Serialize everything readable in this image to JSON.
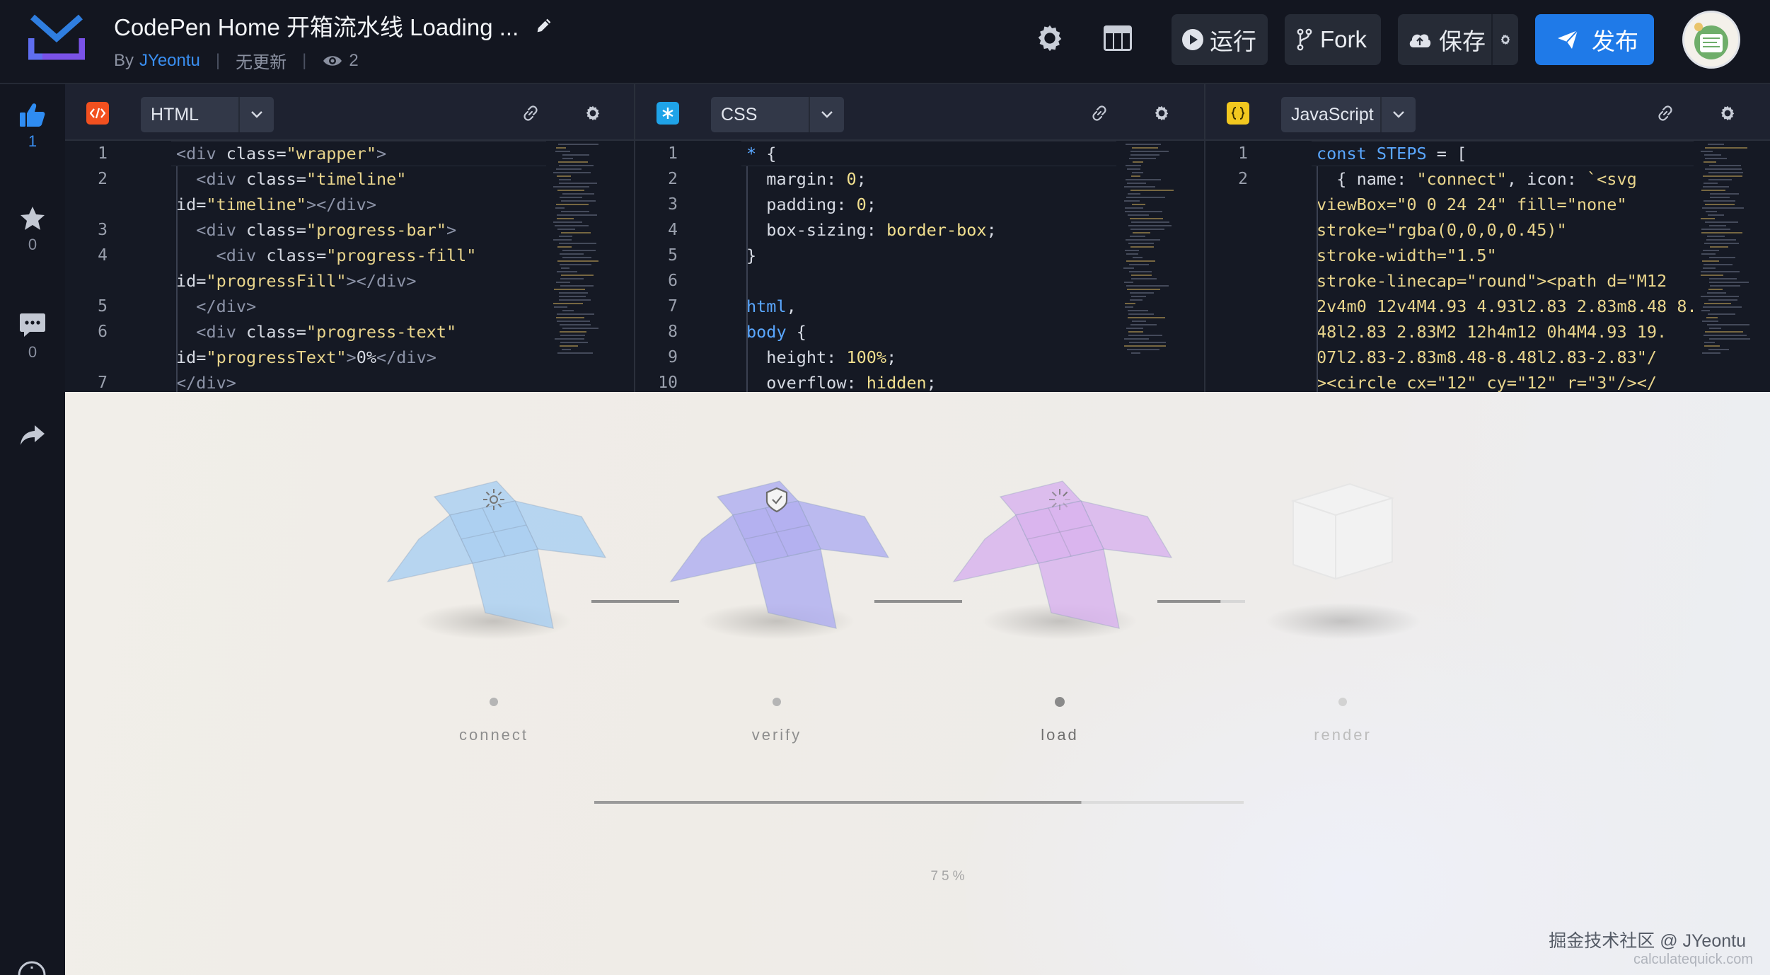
{
  "header": {
    "title": "CodePen Home 开箱流水线 Loading ...",
    "by_label": "By",
    "author": "JYeontu",
    "status": "无更新",
    "views": "2",
    "buttons": {
      "run": "运行",
      "fork": "Fork",
      "save": "保存",
      "publish": "发布"
    }
  },
  "rail": {
    "likes": "1",
    "stars": "0",
    "comments": "0"
  },
  "panes": {
    "html": {
      "label": "HTML",
      "lines": [
        {
          "n": "1",
          "segments": [
            [
              "t",
              "<div "
            ],
            [
              "a",
              "class="
            ],
            [
              "s",
              "\"wrapper\""
            ],
            [
              "t",
              ">"
            ]
          ]
        },
        {
          "n": "2",
          "segments": [
            [
              "p",
              "  "
            ],
            [
              "t",
              "<div "
            ],
            [
              "a",
              "class="
            ],
            [
              "s",
              "\"timeline\""
            ]
          ]
        },
        {
          "n": "",
          "segments": [
            [
              "a",
              "id="
            ],
            [
              "s",
              "\"timeline\""
            ],
            [
              "t",
              "></div>"
            ]
          ]
        },
        {
          "n": "3",
          "segments": [
            [
              "p",
              "  "
            ],
            [
              "t",
              "<div "
            ],
            [
              "a",
              "class="
            ],
            [
              "s",
              "\"progress-bar\""
            ],
            [
              "t",
              ">"
            ]
          ]
        },
        {
          "n": "4",
          "segments": [
            [
              "p",
              "    "
            ],
            [
              "t",
              "<div "
            ],
            [
              "a",
              "class="
            ],
            [
              "s",
              "\"progress-fill\""
            ]
          ]
        },
        {
          "n": "",
          "segments": [
            [
              "a",
              "id="
            ],
            [
              "s",
              "\"progressFill\""
            ],
            [
              "t",
              "></div>"
            ]
          ]
        },
        {
          "n": "5",
          "segments": [
            [
              "p",
              "  "
            ],
            [
              "t",
              "</div>"
            ]
          ]
        },
        {
          "n": "6",
          "segments": [
            [
              "p",
              "  "
            ],
            [
              "t",
              "<div "
            ],
            [
              "a",
              "class="
            ],
            [
              "s",
              "\"progress-text\""
            ]
          ]
        },
        {
          "n": "",
          "segments": [
            [
              "a",
              "id="
            ],
            [
              "s",
              "\"progressText\""
            ],
            [
              "t",
              ">"
            ],
            [
              "p",
              "0%"
            ],
            [
              "t",
              "</div>"
            ]
          ]
        },
        {
          "n": "7",
          "segments": [
            [
              "t",
              "</div>"
            ]
          ]
        }
      ]
    },
    "css": {
      "label": "CSS",
      "lines": [
        {
          "n": "1",
          "segments": [
            [
              "k",
              "* "
            ],
            [
              "p",
              "{"
            ]
          ]
        },
        {
          "n": "2",
          "segments": [
            [
              "p",
              "  margin: "
            ],
            [
              "m",
              "0"
            ],
            [
              "p",
              ";"
            ]
          ]
        },
        {
          "n": "3",
          "segments": [
            [
              "p",
              "  padding: "
            ],
            [
              "m",
              "0"
            ],
            [
              "p",
              ";"
            ]
          ]
        },
        {
          "n": "4",
          "segments": [
            [
              "p",
              "  box-sizing: "
            ],
            [
              "m",
              "border-box"
            ],
            [
              "p",
              ";"
            ]
          ]
        },
        {
          "n": "5",
          "segments": [
            [
              "p",
              "}"
            ]
          ]
        },
        {
          "n": "6",
          "segments": []
        },
        {
          "n": "7",
          "segments": [
            [
              "k",
              "html"
            ],
            [
              "p",
              ","
            ]
          ]
        },
        {
          "n": "8",
          "segments": [
            [
              "k",
              "body "
            ],
            [
              "p",
              "{"
            ]
          ]
        },
        {
          "n": "9",
          "segments": [
            [
              "p",
              "  height: "
            ],
            [
              "m",
              "100%"
            ],
            [
              "p",
              ";"
            ]
          ]
        },
        {
          "n": "10",
          "segments": [
            [
              "p",
              "  overflow: "
            ],
            [
              "m",
              "hidden"
            ],
            [
              "p",
              ";"
            ]
          ]
        }
      ]
    },
    "js": {
      "label": "JavaScript",
      "lines": [
        {
          "n": "1",
          "segments": [
            [
              "k",
              "const STEPS "
            ],
            [
              "p",
              "= ["
            ]
          ]
        },
        {
          "n": "2",
          "segments": [
            [
              "p",
              "  { name: "
            ],
            [
              "s",
              "\"connect\""
            ],
            [
              "p",
              ", icon: "
            ],
            [
              "s",
              "`<svg"
            ]
          ]
        },
        {
          "n": "",
          "segments": [
            [
              "s",
              "viewBox=\"0 0 24 24\" fill=\"none\""
            ]
          ]
        },
        {
          "n": "",
          "segments": [
            [
              "s",
              "stroke=\"rgba(0,0,0,0.45)\""
            ]
          ]
        },
        {
          "n": "",
          "segments": [
            [
              "s",
              "stroke-width=\"1.5\""
            ]
          ]
        },
        {
          "n": "",
          "segments": [
            [
              "s",
              "stroke-linecap=\"round\"><path d=\"M12"
            ]
          ]
        },
        {
          "n": "",
          "segments": [
            [
              "s",
              "2v4m0 12v4M4.93 4.93l2.83 2.83m8.48 8."
            ]
          ]
        },
        {
          "n": "",
          "segments": [
            [
              "s",
              "48l2.83 2.83M2 12h4m12 0h4M4.93 19."
            ]
          ]
        },
        {
          "n": "",
          "segments": [
            [
              "s",
              "07l2.83-2.83m8.48-8.48l2.83-2.83\"/"
            ]
          ]
        },
        {
          "n": "",
          "segments": [
            [
              "s",
              "><circle cx=\"12\" cy=\"12\" r=\"3\"/></"
            ]
          ]
        }
      ]
    }
  },
  "preview": {
    "steps": [
      {
        "name": "connect",
        "state": "done",
        "color": "#a9cff1",
        "icon": "sun-icon"
      },
      {
        "name": "verify",
        "state": "done",
        "color": "#b0aef0",
        "icon": "shield-check-icon"
      },
      {
        "name": "load",
        "state": "active",
        "color": "#d8b2ee",
        "icon": "loader-icon"
      },
      {
        "name": "render",
        "state": "pending",
        "color": "#f2f2f2",
        "icon": "cube-icon"
      }
    ],
    "progress": 0.75,
    "progress_text": "75%"
  },
  "watermark": {
    "main": "掘金技术社区 @ JYeontu",
    "sub": "calculatequick.com"
  },
  "colors": {
    "accent": "#1f7ae8",
    "link": "#3a8ff2",
    "header_bg": "#131620",
    "code_bg": "#151924"
  }
}
